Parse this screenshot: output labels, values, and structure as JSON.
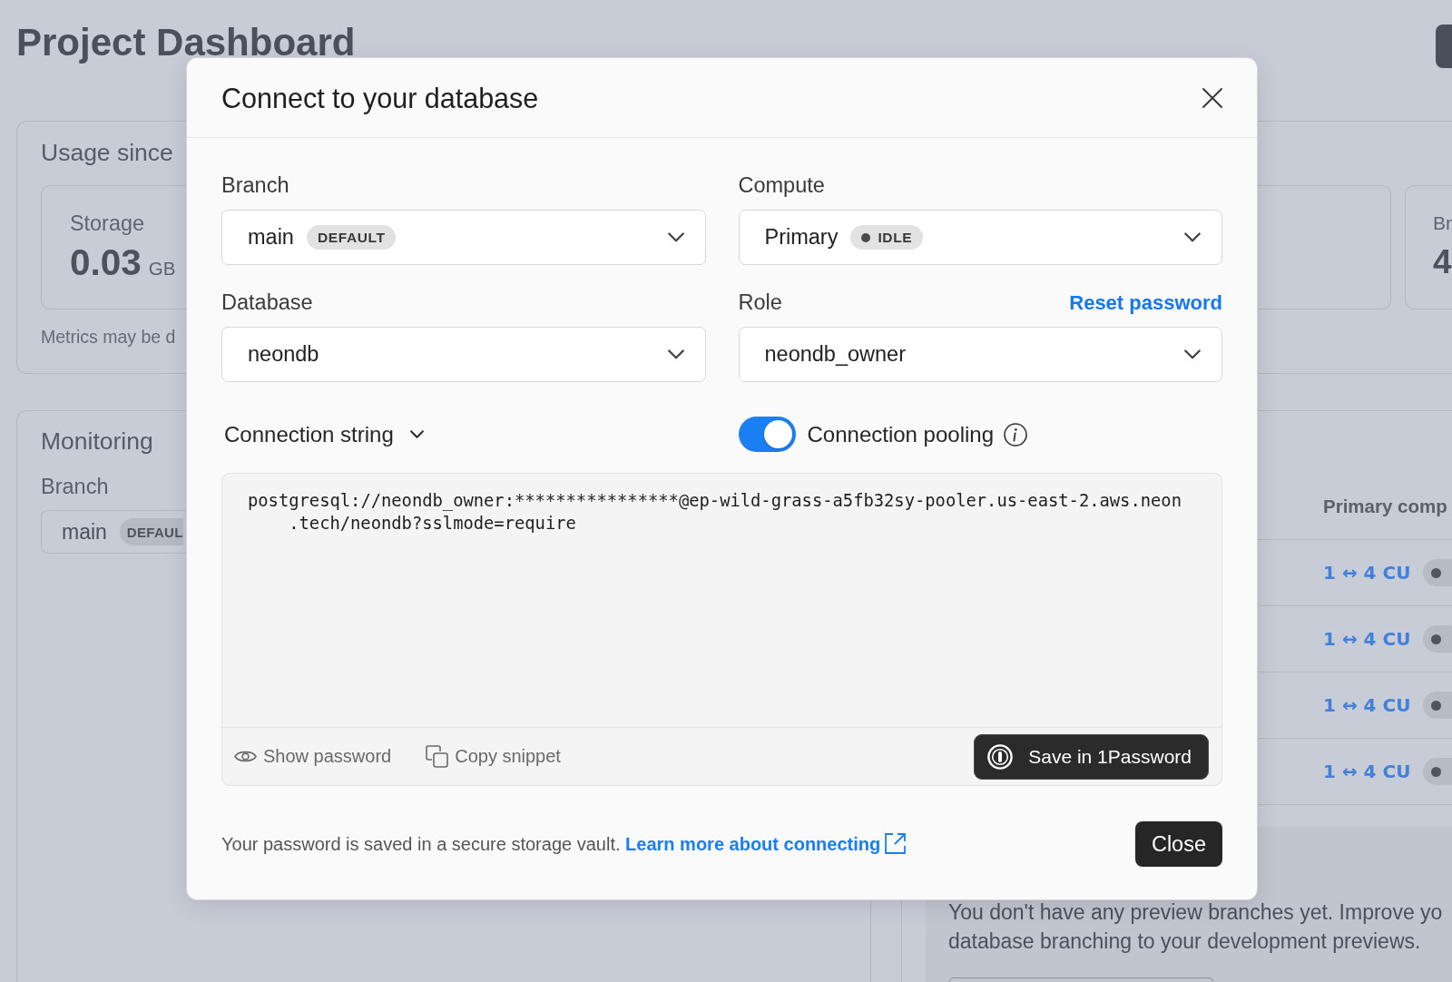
{
  "page_title": "Project Dashboard",
  "usage": {
    "title": "Usage since",
    "stats": [
      {
        "label": "Storage",
        "value": "0.03",
        "unit": "GB"
      },
      {
        "label": "Br",
        "value": "4"
      }
    ],
    "note": "Metrics may be d"
  },
  "monitoring": {
    "title": "Monitoring",
    "branch_label": "Branch",
    "branch": {
      "value": "main",
      "tag": "DEFAUL"
    }
  },
  "computes": {
    "columns": [
      "Primary comp"
    ],
    "rows": [
      {
        "size": "1 ↔ 4 CU"
      },
      {
        "size": "1 ↔ 4 CU"
      },
      {
        "size": "1 ↔ 4 CU"
      },
      {
        "size": "1 ↔ 4 CU"
      }
    ]
  },
  "preview_branches": {
    "message_lines": [
      "You don't have any preview branches yet. Improve yo",
      "database branching to your development previews."
    ]
  },
  "dialog": {
    "title": "Connect to your database",
    "fields": [
      {
        "label": "Branch",
        "value": "main",
        "tag": {
          "text": "DEFAULT",
          "dot": false
        }
      },
      {
        "label": "Compute",
        "value": "Primary",
        "tag": {
          "text": "IDLE",
          "dot": true
        }
      },
      {
        "label": "Database",
        "value": "neondb"
      },
      {
        "label": "Role",
        "value": "neondb_owner",
        "link": "Reset password"
      }
    ],
    "snippet_menu": "Connection string",
    "pooling": {
      "label": "Connection pooling",
      "on": true
    },
    "connection_string_lines": [
      "postgresql://neondb_owner:****************@ep-wild-grass-a5fb32sy-pooler.us-east-2.aws.neon",
      ".tech/neondb?sslmode=require"
    ],
    "snippet_actions": [
      {
        "kind": "eye",
        "label": "Show password"
      },
      {
        "kind": "copy",
        "label": "Copy snippet"
      }
    ],
    "save_button": "Save in 1Password",
    "note": "Your password is saved in a secure storage vault.",
    "note_link": "Learn more about connecting",
    "close_button": "Close"
  }
}
